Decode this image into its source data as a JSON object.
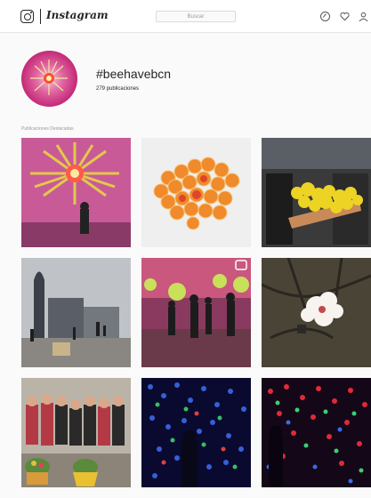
{
  "topbar": {
    "brand": "Instagram",
    "search_placeholder": "Buscar"
  },
  "header": {
    "hashtag": "#beehavebcn",
    "post_count": "279 publicaciones"
  },
  "section": {
    "title": "Publicaciones Destacadas"
  },
  "posts": [
    {
      "label": "pink-room-installation"
    },
    {
      "label": "orange-hexagon-flowers"
    },
    {
      "label": "yellow-mimosa-bouquet"
    },
    {
      "label": "agbar-tower-street"
    },
    {
      "label": "green-light-spheres-room"
    },
    {
      "label": "white-blossom-branch"
    },
    {
      "label": "group-of-students"
    },
    {
      "label": "blue-light-tunnel"
    },
    {
      "label": "red-green-light-tunnel"
    }
  ]
}
